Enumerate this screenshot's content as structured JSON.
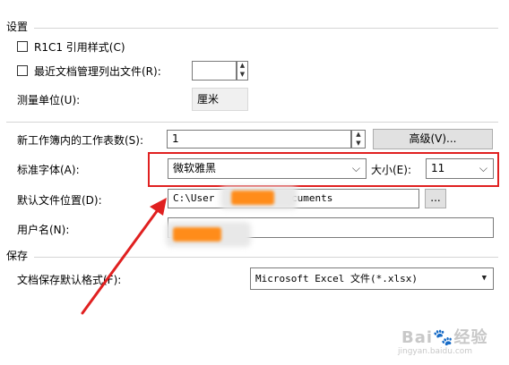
{
  "settings": {
    "title": "设置",
    "r1c1_label": "R1C1 引用样式(C)",
    "recent_docs_label": "最近文档管理列出文件(R):",
    "recent_docs_value": "",
    "unit_label": "测量单位(U):",
    "unit_value": "厘米"
  },
  "workbook": {
    "sheets_label": "新工作簿内的工作表数(S):",
    "sheets_value": "1",
    "advanced_button": "高级(V)...",
    "font_label": "标准字体(A):",
    "font_value": "微软雅黑",
    "size_label": "大小(E):",
    "size_value": "11",
    "location_label": "默认文件位置(D):",
    "location_value_prefix": "C:\\User",
    "location_value_suffix": "cuments",
    "browse_button": "...",
    "username_label": "用户名(N):",
    "username_value": ""
  },
  "save": {
    "title": "保存",
    "format_label": "文档保存默认格式(F):",
    "format_value": "Microsoft Excel 文件(*.xlsx)"
  },
  "watermark": {
    "brand": "Bai",
    "brand_suffix": "经验",
    "url": "jingyan.baidu.com"
  },
  "colors": {
    "highlight_box": "#e02020",
    "arrow": "#e02020",
    "redaction": "#ff8c1a"
  }
}
